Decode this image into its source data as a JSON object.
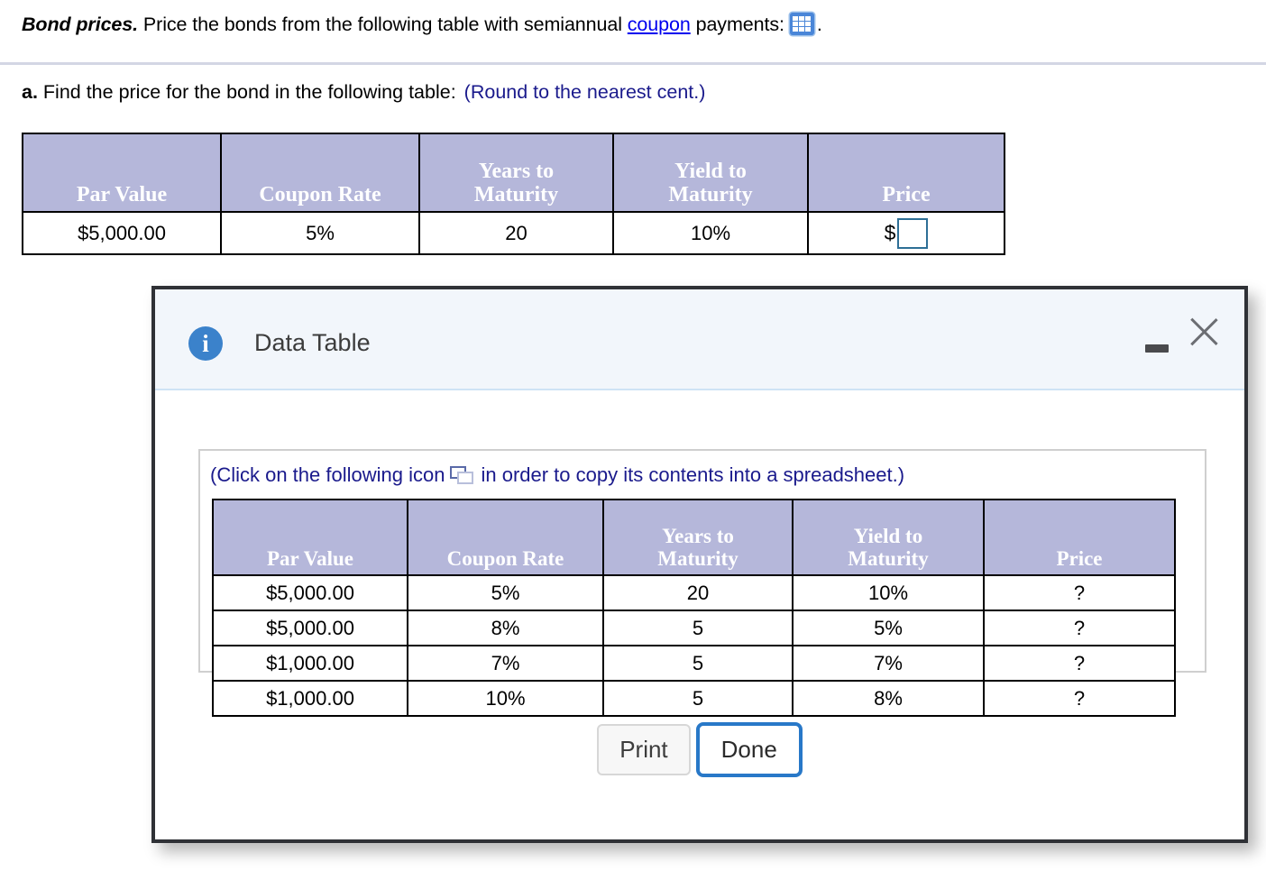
{
  "problem": {
    "lead": "Bond prices.",
    "text_before_link": " Price the bonds from the following table with semiannual ",
    "link_text": "coupon",
    "text_after_link": " payments:",
    "trailing_period": ".",
    "grid_icon_name": "grid-table-icon"
  },
  "part_a": {
    "label": "a.",
    "text": " Find the price for the bond in the following table:",
    "round_note": "(Round to the nearest cent.)"
  },
  "top_table": {
    "headers": [
      "Par Value",
      "Coupon Rate",
      "Years to Maturity",
      "Yield to Maturity",
      "Price"
    ],
    "headers_line1": [
      "",
      "",
      "Years to",
      "Yield to",
      ""
    ],
    "headers_line2": [
      "Par Value",
      "Coupon Rate",
      "Maturity",
      "Maturity",
      "Price"
    ],
    "row": {
      "par_value": "$5,000.00",
      "coupon_rate": "5%",
      "years_to_maturity": "20",
      "yield_to_maturity": "10%",
      "price_prefix": "$",
      "price_value": "",
      "price_placeholder": ""
    }
  },
  "dialog": {
    "title": "Data Table",
    "info_icon_glyph": "i",
    "minimize_label": "Minimize",
    "close_label": "Close",
    "copy_instruction_before": "(Click on the following icon",
    "copy_instruction_after": "in order to copy its contents into a spreadsheet.)",
    "table": {
      "headers_line1": [
        "",
        "",
        "Years to",
        "Yield to",
        ""
      ],
      "headers_line2": [
        "Par Value",
        "Coupon Rate",
        "Maturity",
        "Maturity",
        "Price"
      ],
      "rows": [
        [
          "$5,000.00",
          "5%",
          "20",
          "10%",
          "?"
        ],
        [
          "$5,000.00",
          "8%",
          "5",
          "5%",
          "?"
        ],
        [
          "$1,000.00",
          "7%",
          "5",
          "7%",
          "?"
        ],
        [
          "$1,000.00",
          "10%",
          "5",
          "8%",
          "?"
        ]
      ]
    },
    "buttons": {
      "print": "Print",
      "done": "Done"
    }
  },
  "colors": {
    "table_header_bg": "#b5b7da",
    "dialog_header_bg": "#f2f6fb",
    "dialog_border": "#2f3136",
    "accent_blue": "#2878c8",
    "info_blue": "#3b82cb",
    "link_blue": "#0000ee",
    "note_navy": "#1a1a8c",
    "input_border": "#2e6f96"
  }
}
